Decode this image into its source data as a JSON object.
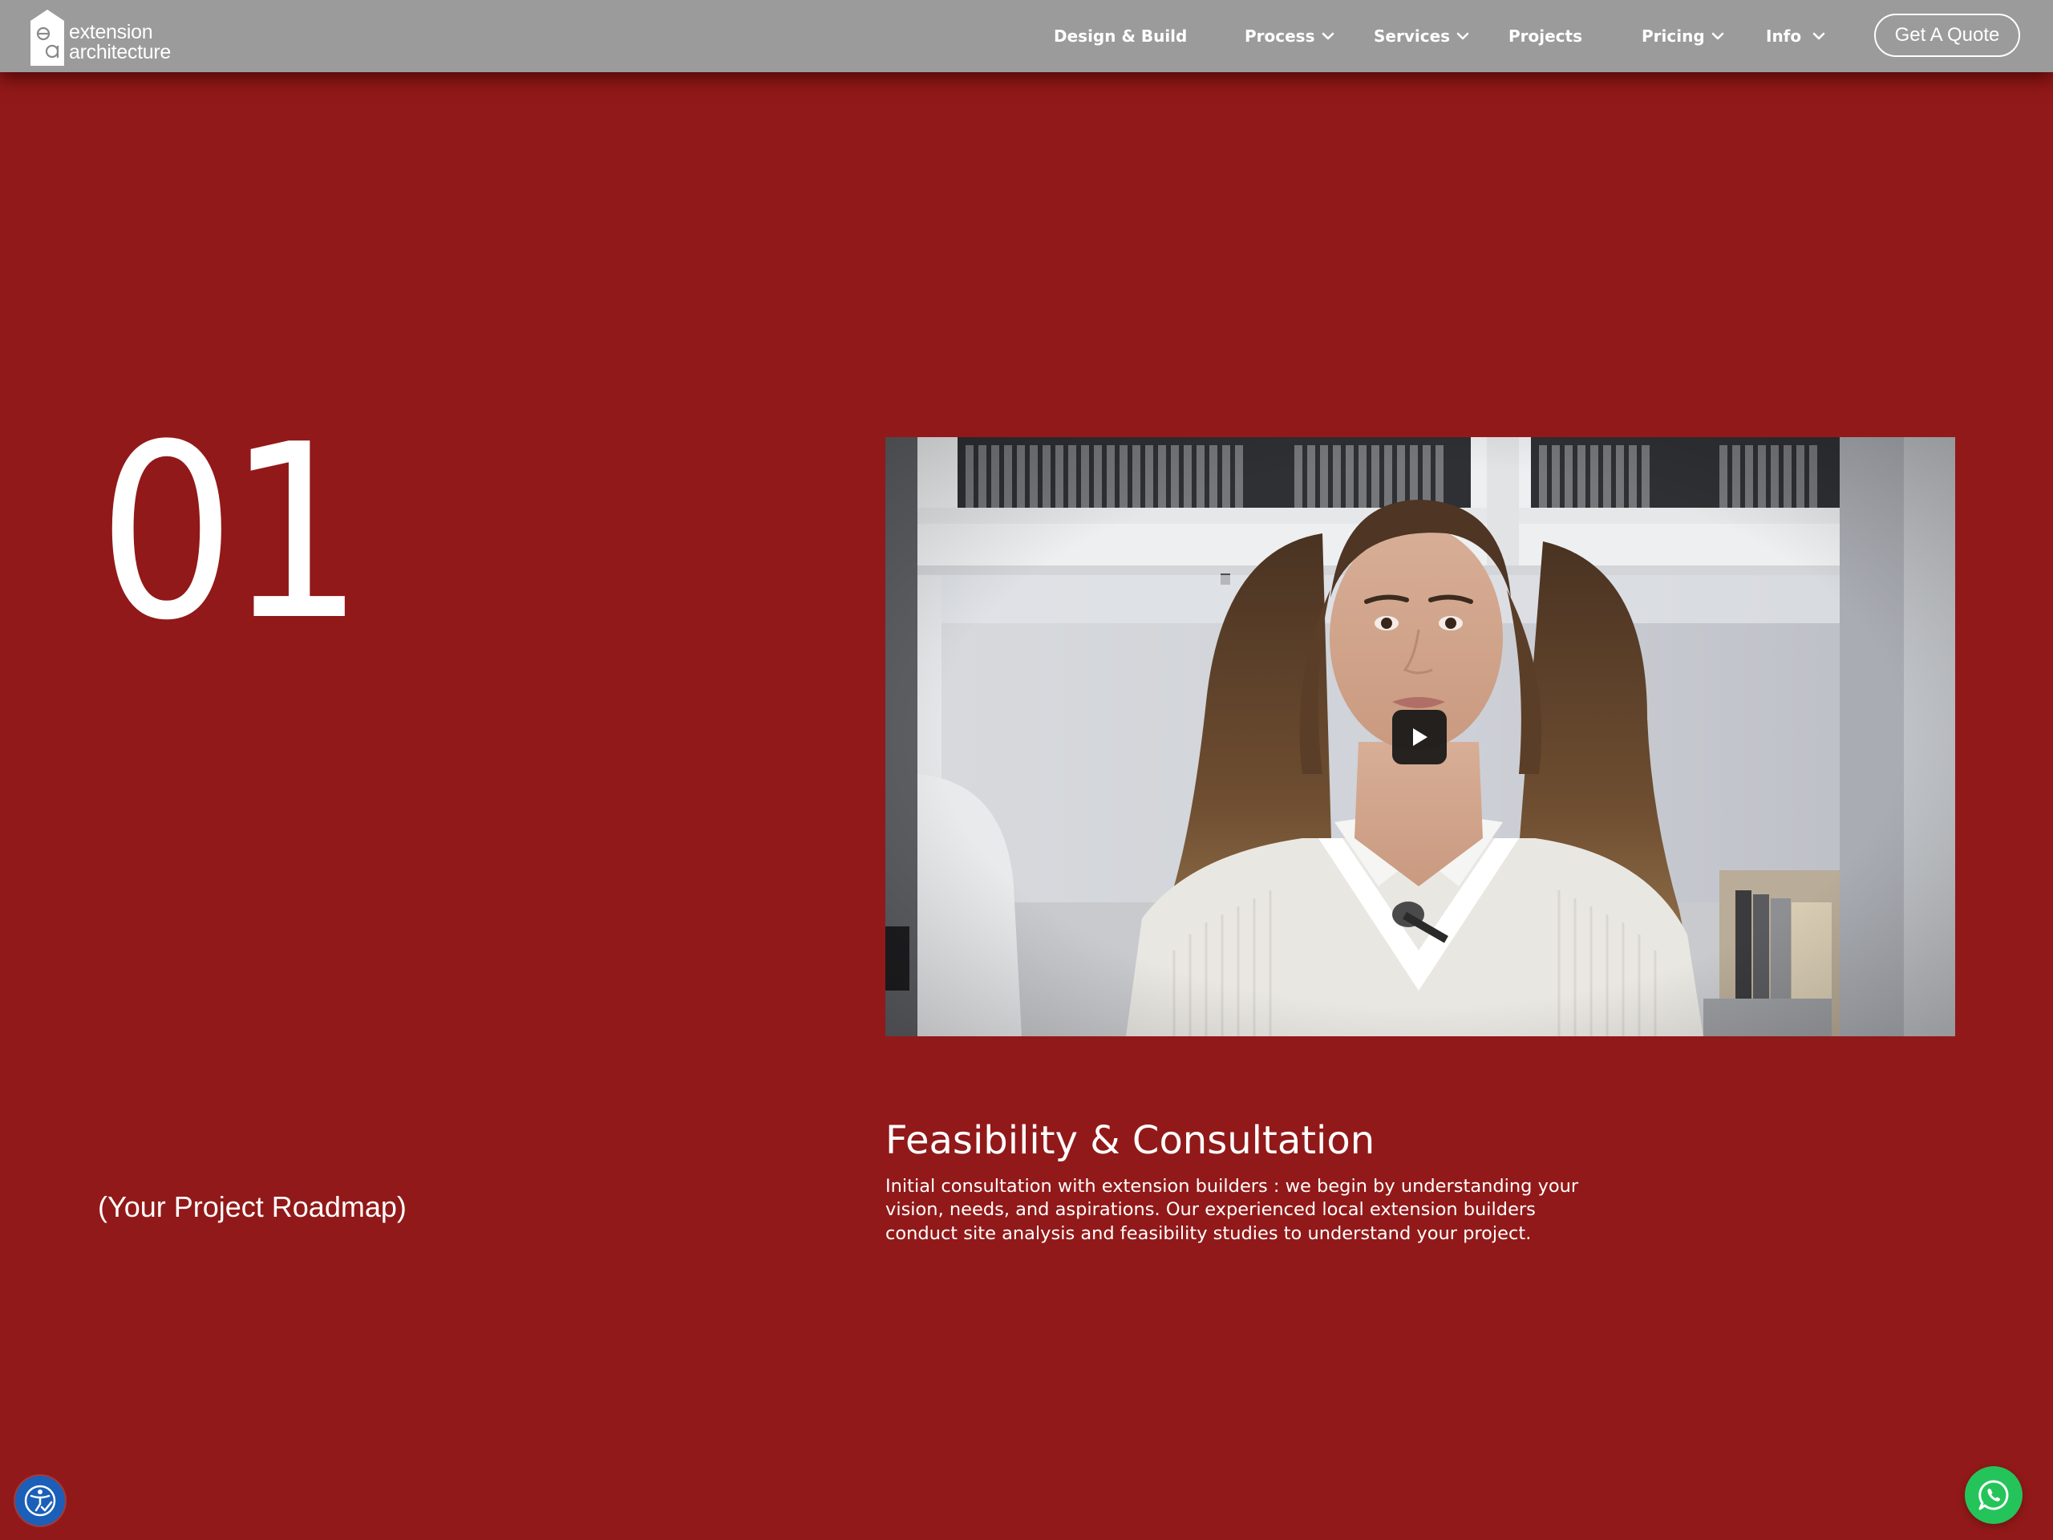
{
  "brand": {
    "logo_line1": "extension",
    "logo_line2": "architecture",
    "logo_mark_letters": "ea"
  },
  "nav": {
    "items": [
      {
        "label": "Design & Build",
        "has_dropdown": false
      },
      {
        "label": "Process",
        "has_dropdown": true
      },
      {
        "label": "Services",
        "has_dropdown": true
      },
      {
        "label": "Projects",
        "has_dropdown": false
      },
      {
        "label": "Pricing",
        "has_dropdown": true
      },
      {
        "label": "Info",
        "has_dropdown": true
      }
    ],
    "cta_label": "Get A Quote"
  },
  "step": {
    "number": "01",
    "roadmap_label": "(Your Project Roadmap)",
    "title": "Feasibility & Consultation",
    "description": "Initial consultation with extension builders : we begin by understanding your vision, needs, and aspirations. Our experienced local extension builders conduct site analysis and feasibility studies to understand your project."
  },
  "video": {
    "icon": "play-icon"
  },
  "floating": {
    "accessibility_icon": "accessibility-icon",
    "whatsapp_icon": "whatsapp-icon"
  },
  "colors": {
    "page_background": "#921919",
    "header_background": "#9b9b9b",
    "text": "#ffffff",
    "accessibility_button": "#1b5fb8",
    "whatsapp_button": "#25c45a"
  }
}
